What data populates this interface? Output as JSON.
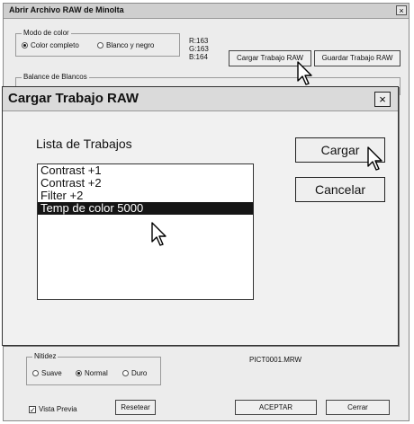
{
  "window": {
    "title": "Abrir Archivo RAW de Minolta",
    "close": "×"
  },
  "color_mode": {
    "legend": "Modo de color",
    "options": [
      "Color completo",
      "Blanco y negro"
    ],
    "selected": "Color completo"
  },
  "rgb_readout": {
    "r": "R:163",
    "g": "G:163",
    "b": "B:164"
  },
  "job_buttons": {
    "load": "Cargar Trabajo RAW",
    "save": "Guardar Trabajo RAW"
  },
  "white_balance": {
    "legend": "Balance de Blancos"
  },
  "dialog": {
    "title": "Cargar Trabajo RAW",
    "close": "×",
    "list_label": "Lista de Trabajos",
    "items": [
      "Contrast +1",
      "Contrast +2",
      "Filter +2",
      "Temp de color 5000"
    ],
    "selected_item": "Temp de color 5000",
    "load_button": "Cargar",
    "cancel_button": "Cancelar"
  },
  "sharpness": {
    "legend": "Nitidez",
    "options": [
      "Suave",
      "Normal",
      "Duro"
    ],
    "selected": "Normal"
  },
  "filename": "PICT0001.MRW",
  "preview": {
    "label": "Vista Previa",
    "checked": true,
    "mark": "✓"
  },
  "buttons": {
    "reset": "Resetear",
    "accept": "ACEPTAR",
    "close": "Cerrar"
  }
}
